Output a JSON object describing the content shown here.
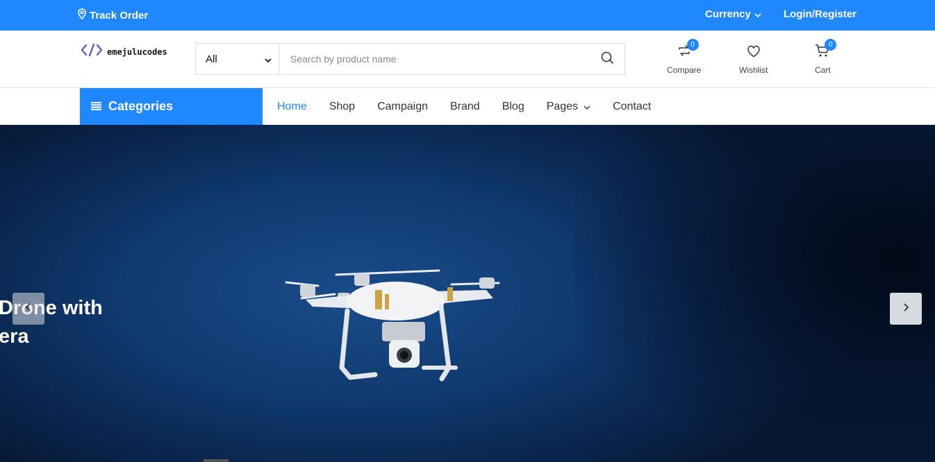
{
  "topbar": {
    "track_order": "Track Order",
    "currency": "Currency",
    "login": "Login/Register"
  },
  "header": {
    "logo_text": "emejulucodes",
    "search": {
      "category_selected": "All",
      "placeholder": "Search by product name"
    },
    "compare": {
      "label": "Compare",
      "count": "0"
    },
    "wishlist": {
      "label": "Wishlist"
    },
    "cart": {
      "label": "Cart",
      "count": "0"
    }
  },
  "nav": {
    "categories_label": "Categories",
    "items": [
      "Home",
      "Shop",
      "Campaign",
      "Brand",
      "Blog",
      "Pages",
      "Contact"
    ],
    "active": "Home"
  },
  "hero": {
    "headline_line1": "Drone with",
    "headline_line2": "era"
  },
  "colors": {
    "accent": "#1f87ff",
    "hero_bg": "#0b2a55"
  },
  "icons": {
    "track": "map-pin-icon",
    "currency": "chevron-down-icon",
    "search": "search-icon",
    "compare": "compare-arrows-icon",
    "wishlist": "heart-icon",
    "cart": "cart-icon",
    "categories": "menu-lines-icon",
    "slider_prev": "chevron-left-icon",
    "slider_next": "chevron-right-icon"
  }
}
